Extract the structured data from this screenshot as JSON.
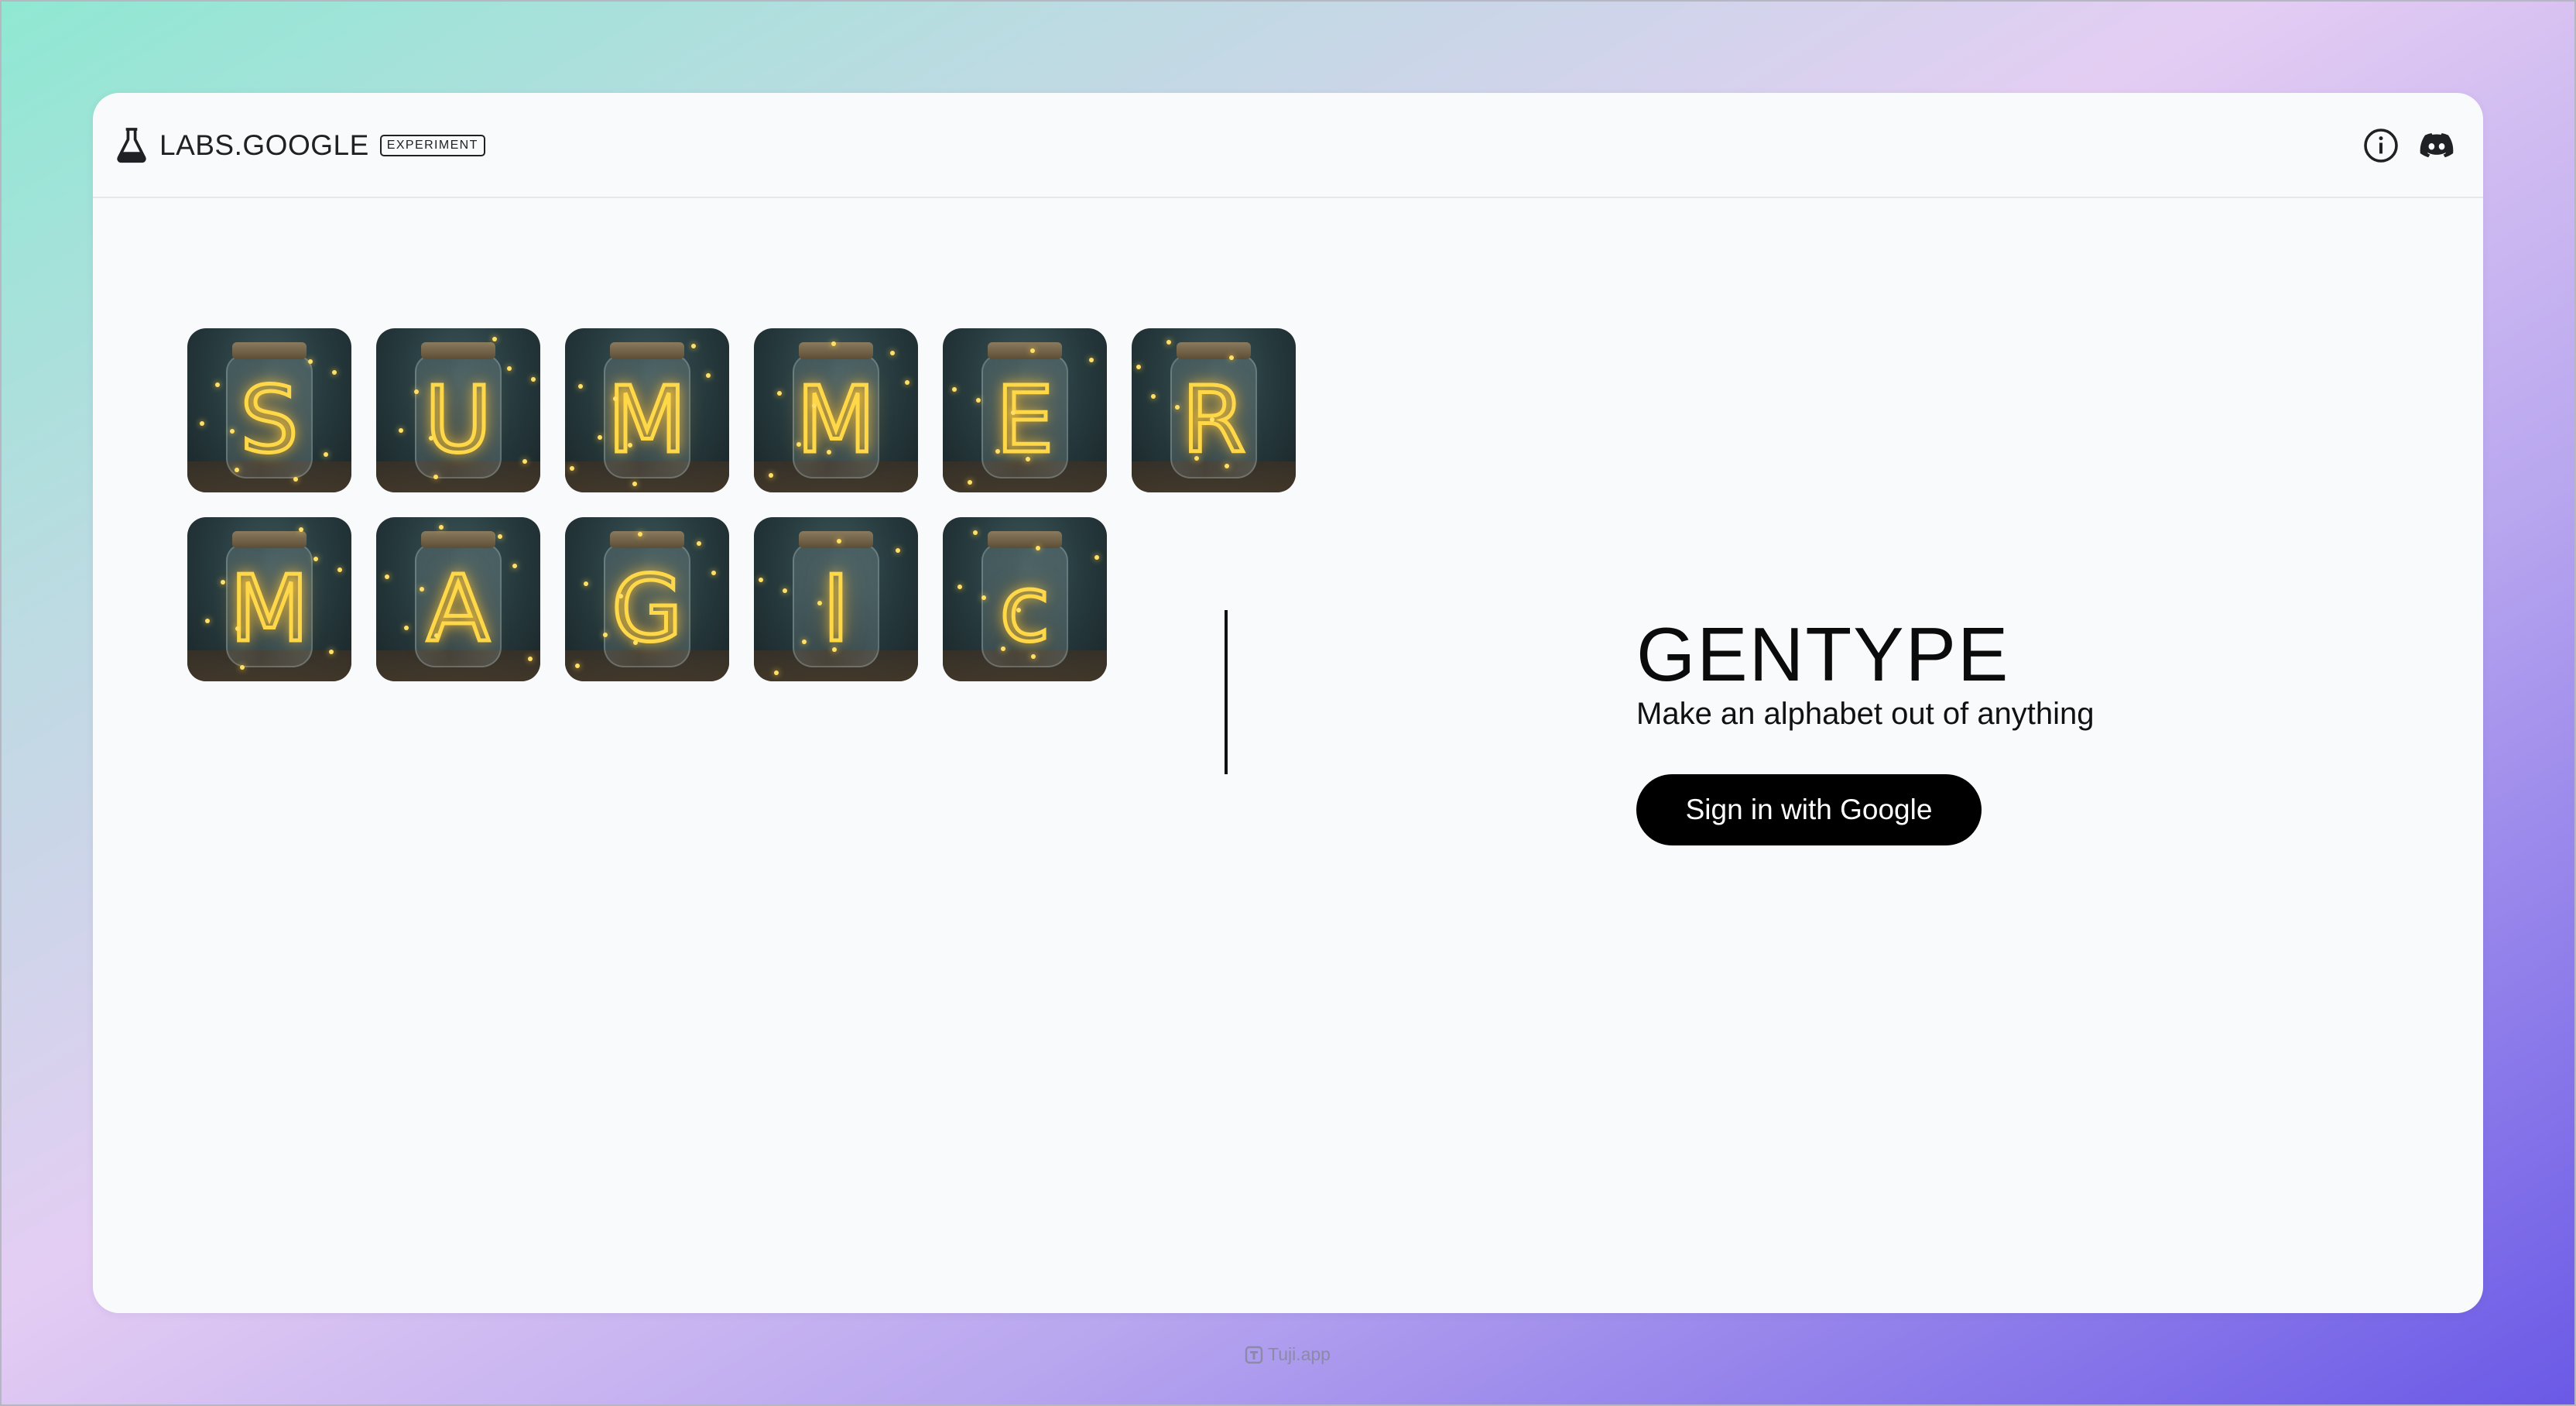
{
  "header": {
    "brand": "LABS.GOOGLE",
    "badge": "EXPERIMENT",
    "icons": [
      "flask-icon",
      "info-icon",
      "discord-icon"
    ]
  },
  "showcase": {
    "row1": [
      "S",
      "U",
      "M",
      "M",
      "E",
      "R"
    ],
    "row2": [
      "M",
      "A",
      "G",
      "I",
      "c"
    ]
  },
  "hero": {
    "title": "GENTYPE",
    "subtitle": "Make an alphabet out of anything",
    "signin_label": "Sign in with Google"
  },
  "footer": {
    "watermark": "Tuji.app"
  },
  "colors": {
    "accent_button": "#000000",
    "glow": "#ffd84a"
  }
}
